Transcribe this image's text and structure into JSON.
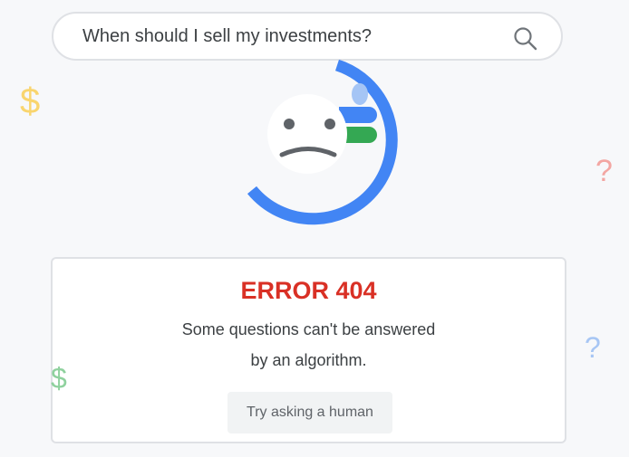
{
  "search": {
    "value": "When should I sell my investments?",
    "icon": "search-icon"
  },
  "decorations": {
    "dollar": "$",
    "question": "?"
  },
  "illustration": {
    "icon": "sad-face-icon",
    "colors": {
      "ring": "#4285f4",
      "bar_green": "#34a853",
      "face": "#ffffff",
      "features": "#5f6368"
    }
  },
  "error": {
    "title": "ERROR 404",
    "line1": "Some questions can't be answered",
    "line2": "by an algorithm.",
    "button_label": "Try asking a human"
  },
  "colors": {
    "background": "#f7f8fa",
    "error_red": "#d93025",
    "text": "#3c4043",
    "dollar_yellow": "#f9d56e",
    "dollar_green": "#8fd19e",
    "question_red": "#f3a6a2",
    "question_blue": "#a7c6f4"
  }
}
